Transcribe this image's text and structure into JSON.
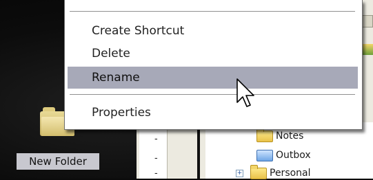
{
  "context_menu": {
    "items": [
      {
        "label": "Create Shortcut",
        "highlighted": false
      },
      {
        "label": "Delete",
        "highlighted": false
      },
      {
        "label": "Rename",
        "highlighted": true
      },
      {
        "label": "Properties",
        "highlighted": false
      }
    ]
  },
  "desktop": {
    "folder_label": "New Folder"
  },
  "explorer": {
    "left_pane_dashes": [
      "-",
      "-",
      "-"
    ],
    "tree": [
      {
        "label": "Notes",
        "icon": "folder-icon"
      },
      {
        "label": "Outbox",
        "icon": "outbox-icon"
      },
      {
        "label": "Personal",
        "icon": "folder-icon",
        "expander": "+"
      }
    ]
  },
  "colors": {
    "menu_highlight": "#a7a9b8",
    "desktop_background": "#0b0b0b"
  }
}
